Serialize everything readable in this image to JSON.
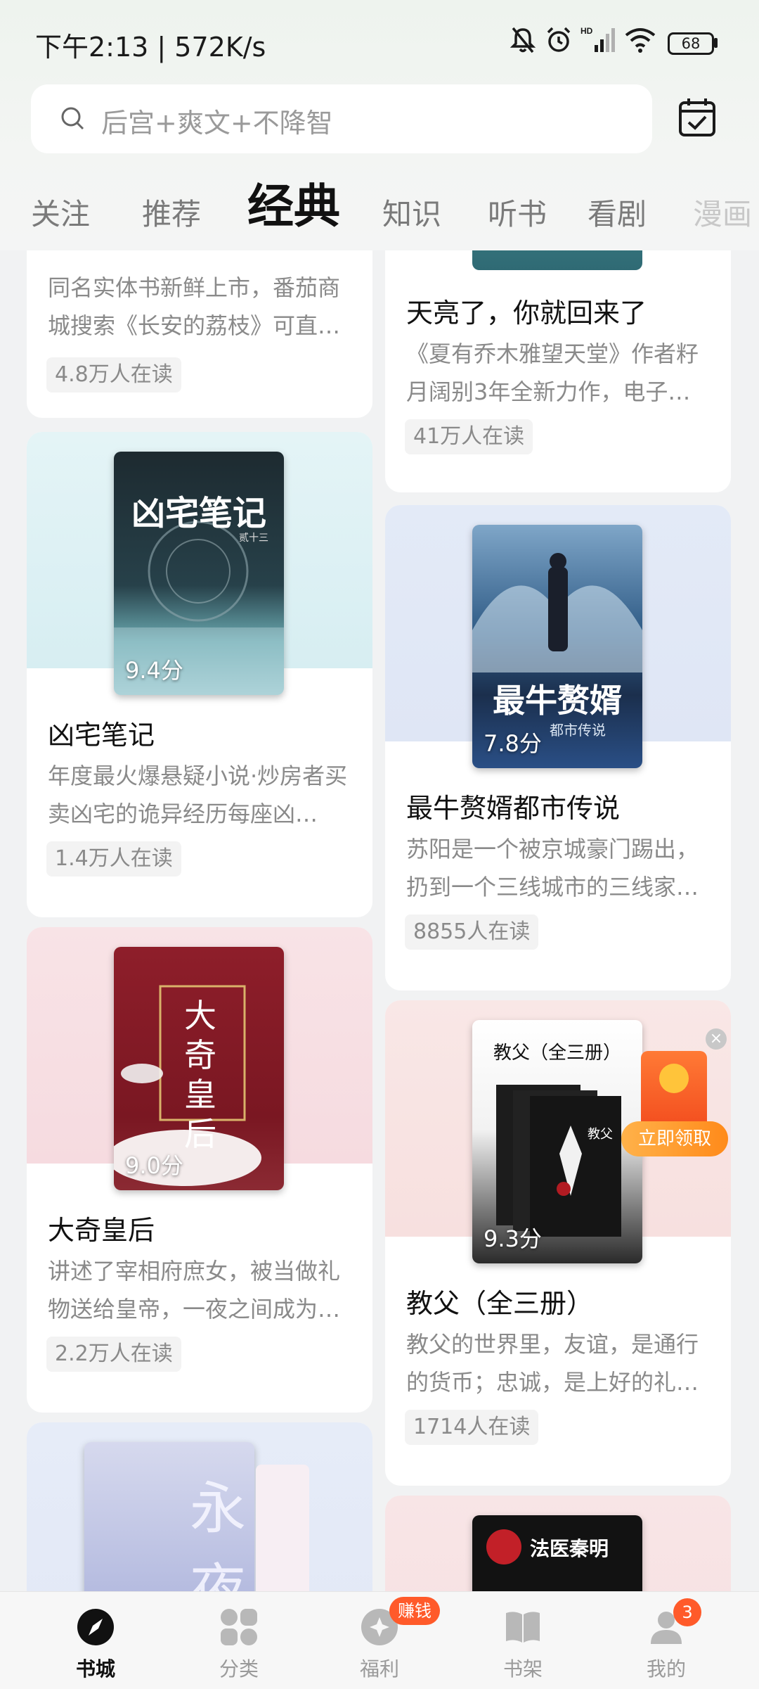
{
  "status_bar": {
    "time": "下午2:13 | 572K/s",
    "battery": "68"
  },
  "search": {
    "placeholder": "后宫+爽文+不降智"
  },
  "tabs": [
    "关注",
    "推荐",
    "经典",
    "知识",
    "听书",
    "看剧",
    "漫画"
  ],
  "active_tab": "经典",
  "cards": [
    {
      "title": "",
      "desc": "同名实体书新鲜上市，番茄商城搜索《长安的荔枝》可直…",
      "readers": "4.8万人在读",
      "score": ""
    },
    {
      "title": "天亮了，你就回来了",
      "desc": "《夏有乔木雅望天堂》作者籽月阔别3年全新力作，电子…",
      "readers": "41万人在读",
      "score": ""
    },
    {
      "title": "凶宅笔记",
      "desc": "年度最火爆悬疑小说·炒房者买卖凶宅的诡异经历每座凶…",
      "readers": "1.4万人在读",
      "score": "9.4分",
      "cover_title": "凶宅笔记",
      "cover_author": "贰十三"
    },
    {
      "title": "最牛赘婿都市传说",
      "desc": "苏阳是一个被京城豪门踢出，扔到一个三线城市的三线家…",
      "readers": "8855人在读",
      "score": "7.8分",
      "cover_title": "最牛赘婿",
      "cover_sub": "都市传说"
    },
    {
      "title": "大奇皇后",
      "desc": "讲述了宰相府庶女，被当做礼物送给皇帝，一夜之间成为…",
      "readers": "2.2万人在读",
      "score": "9.0分",
      "cover_title": "大奇皇后"
    },
    {
      "title": "教父（全三册）",
      "desc": "教父的世界里，友谊，是通行的货币；忠诚，是上好的礼…",
      "readers": "1714人在读",
      "score": "9.3分",
      "cover_title": "教父（全三册）",
      "cover_book_label": "教父"
    },
    {
      "cover_title": "永夜"
    },
    {
      "cover_title": "法医秦明"
    }
  ],
  "promo": {
    "button": "立即领取",
    "close": "×"
  },
  "bottom_nav": [
    {
      "label": "书城",
      "icon": "compass-icon",
      "active": true
    },
    {
      "label": "分类",
      "icon": "grid-icon",
      "active": false
    },
    {
      "label": "福利",
      "icon": "gift-icon",
      "active": false
    },
    {
      "label": "书架",
      "icon": "book-icon",
      "active": false
    },
    {
      "label": "我的",
      "icon": "user-icon",
      "active": false
    }
  ],
  "badges": {
    "welfare": "赚钱",
    "mine": "3"
  },
  "colors": {
    "accent": "#ff5a2a",
    "active_text": "#111111",
    "muted_text": "#8a8a8a"
  }
}
